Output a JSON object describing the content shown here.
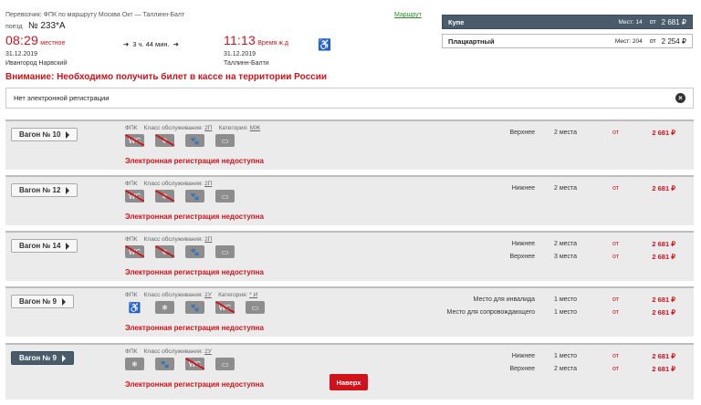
{
  "header": {
    "carrier_line": "Перевозчик: ФПК   по маршруту Москва Окт — Таллинн-Балт",
    "train_prefix": "поезд",
    "train_number": "№ 233*А",
    "route_link": "Маршрут",
    "departure": {
      "time": "08:29",
      "tz": "местное",
      "date": "31.12.2019",
      "station": "Ивангород Нарвский"
    },
    "duration": "3 ч. 44 мин.",
    "arrival": {
      "time": "11:13",
      "tz": "Время ж.д",
      "date": "31.12.2019",
      "station": "Таллинн-Балти"
    },
    "accessibility_icon": "wheelchair-icon"
  },
  "classes": [
    {
      "name": "Купе",
      "free_label": "Мест: 14",
      "from": "от",
      "price": "2 681 ₽",
      "active": true
    },
    {
      "name": "Плацкартный",
      "free_label": "Мест: 204",
      "from": "от",
      "price": "2 254 ₽",
      "active": false
    }
  ],
  "warning": "Внимание: Необходимо получить билет в кассе на территории России",
  "reg_notice": "Нет электронной регистрации",
  "cars": [
    {
      "button": "Вагон  № 10",
      "meta_carrier": "ФПК",
      "meta_class_label": "Класс обслуживания:",
      "meta_class": "2П",
      "meta_cat_label": "Категория:",
      "meta_cat": "МЖ",
      "noreg": "Электронная регистрация недоступна",
      "seats": [
        {
          "type": "Верхнее",
          "count": "2 места",
          "from": "от",
          "price": "2 681 ₽"
        }
      ]
    },
    {
      "button": "Вагон  № 12",
      "meta_carrier": "ФПК",
      "meta_class_label": "Класс обслуживания:",
      "meta_class": "2П",
      "noreg": "Электронная регистрация недоступна",
      "seats": [
        {
          "type": "Нижнее",
          "count": "2 места",
          "from": "от",
          "price": "2 681 ₽"
        }
      ]
    },
    {
      "button": "Вагон  № 14",
      "meta_carrier": "ФПК",
      "meta_class_label": "Класс обслуживания:",
      "meta_class": "2П",
      "noreg": "Электронная регистрация недоступна",
      "seats": [
        {
          "type": "Нижнее",
          "count": "2 места",
          "from": "от",
          "price": "2 681 ₽"
        },
        {
          "type": "Верхнее",
          "count": "3 места",
          "from": "от",
          "price": "2 681 ₽"
        }
      ]
    },
    {
      "button": "Вагон  № 9",
      "meta_carrier": "ФПК",
      "meta_class_label": "Класс обслуживания:",
      "meta_class": "2У",
      "meta_cat_label": "Категория:",
      "meta_cat": "* И",
      "noreg": "Электронная регистрация недоступна",
      "seats": [
        {
          "type": "Место для инвалида",
          "count": "1 место",
          "from": "от",
          "price": "2 681 ₽"
        },
        {
          "type": "Место для сопровождающего",
          "count": "1 место",
          "from": "от",
          "price": "2 681 ₽"
        }
      ]
    },
    {
      "button": "Вагон  № 9",
      "meta_carrier": "ФПК",
      "meta_class_label": "Класс обслуживания:",
      "meta_class": "2У",
      "noreg": "Электронная регистрация недоступна",
      "seats": [
        {
          "type": "Нижнее",
          "count": "1 место",
          "from": "от",
          "price": "2 681 ₽"
        },
        {
          "type": "Верхнее",
          "count": "2 места",
          "from": "от",
          "price": "2 681 ₽"
        }
      ]
    }
  ],
  "top_button": "Наверх",
  "colors": {
    "accent_red": "#d0121b",
    "dark_slate": "#4a5b6b",
    "link_green": "#2e8b2e"
  }
}
